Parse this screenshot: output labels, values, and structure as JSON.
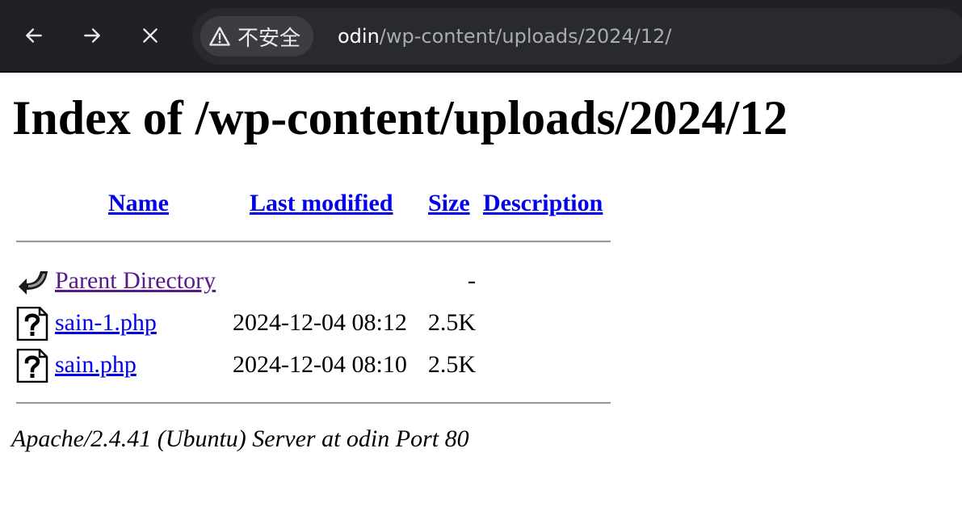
{
  "browser": {
    "security_label": "不安全",
    "url_host": "odin",
    "url_path": "/wp-content/uploads/2024/12/",
    "icons": {
      "back": "arrow-left-icon",
      "forward": "arrow-right-icon",
      "stop": "close-icon",
      "security": "warning-triangle-icon"
    }
  },
  "page": {
    "title": "Index of /wp-content/uploads/2024/12",
    "columns": {
      "name": "Name",
      "last_modified": "Last modified",
      "size": "Size",
      "description": "Description"
    },
    "parent": {
      "label": "Parent Directory",
      "size": "-",
      "icon": "back-arrow-icon"
    },
    "files": [
      {
        "name": "sain-1.php",
        "modified": "2024-12-04 08:12",
        "size": "2.5K",
        "icon": "unknown-file-icon"
      },
      {
        "name": "sain.php",
        "modified": "2024-12-04 08:10",
        "size": "2.5K",
        "icon": "unknown-file-icon"
      }
    ],
    "footer": "Apache/2.4.41 (Ubuntu) Server at odin Port 80"
  }
}
